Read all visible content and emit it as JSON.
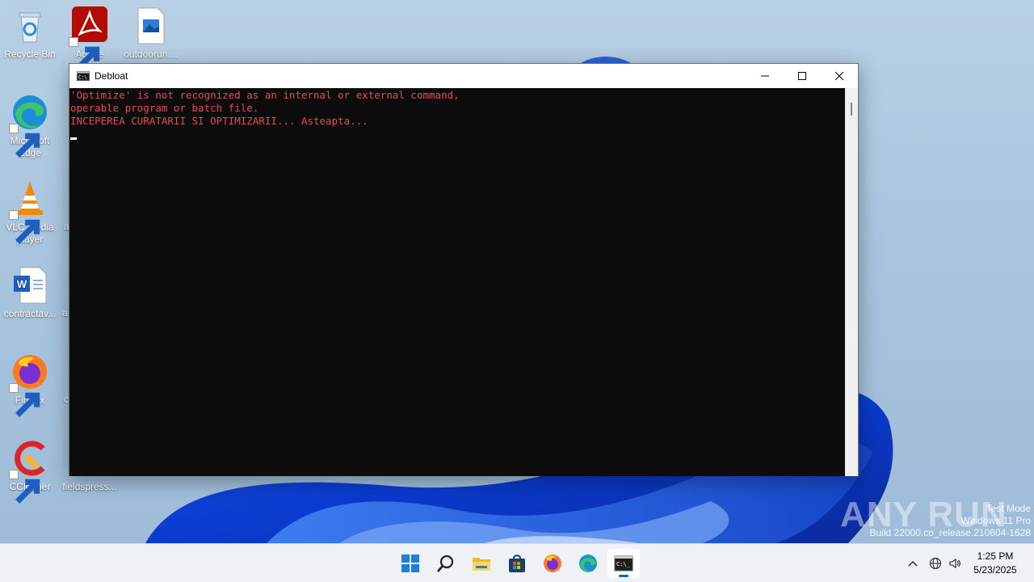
{
  "desktop": {
    "icons": [
      {
        "label": "Recycle Bin",
        "icon": "recycle-bin-icon"
      },
      {
        "label": "Adobe",
        "label2": "Acrobat",
        "icon": "adobe-acrobat-icon"
      },
      {
        "label": "outdoorun....",
        "icon": "image-file-icon"
      },
      {
        "label": "Microsoft",
        "label2": "Edge",
        "icon": "edge-icon"
      },
      {
        "label": "VLC media",
        "label2": "player",
        "icon": "vlc-icon"
      },
      {
        "label": "contractav...",
        "icon": "word-file-icon"
      },
      {
        "label": "Firefox",
        "icon": "firefox-icon"
      },
      {
        "label": "CCleaner",
        "icon": "ccleaner-icon"
      },
      {
        "label": "fieldspress...",
        "icon": "file-icon"
      }
    ],
    "clipped_labels": [
      "a",
      "a",
      "c"
    ]
  },
  "window": {
    "title": "Debloat",
    "console_lines": [
      "'Optimize' is not recognized as an internal or external command,",
      "operable program or batch file.",
      "INCEPEREA CURATARII SI OPTIMIZARII... Asteapta..."
    ],
    "console_color": "#e74856"
  },
  "watermark": {
    "brand": "ANY RUN",
    "line1": "Test Mode",
    "line2": "Windows 11 Pro",
    "line3": "Build 22000.co_release.210604-1628"
  },
  "taskbar": {
    "apps": [
      "start-icon",
      "search-icon",
      "file-explorer-icon",
      "store-icon",
      "firefox-icon",
      "edge-icon",
      "terminal-icon"
    ],
    "active_app": "terminal-icon",
    "accent": "#0067c0"
  },
  "clock": {
    "time": "1:25 PM",
    "date": "5/23/2025"
  }
}
